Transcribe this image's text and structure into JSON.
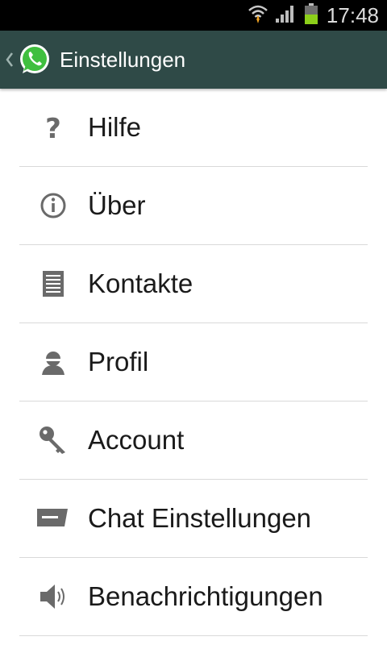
{
  "status_bar": {
    "time": "17:48",
    "icons": [
      "wifi-icon",
      "signal-icon",
      "battery-icon"
    ]
  },
  "action_bar": {
    "title": "Einstellungen",
    "logo": "whatsapp-logo",
    "background": "#2f4a47"
  },
  "menu": {
    "items": [
      {
        "label": "Hilfe",
        "icon": "question-icon"
      },
      {
        "label": "Über",
        "icon": "info-icon"
      },
      {
        "label": "Kontakte",
        "icon": "contacts-icon"
      },
      {
        "label": "Profil",
        "icon": "profile-icon"
      },
      {
        "label": "Account",
        "icon": "key-icon"
      },
      {
        "label": "Chat Einstellungen",
        "icon": "chat-icon"
      },
      {
        "label": "Benachrichtigungen",
        "icon": "speaker-icon"
      }
    ]
  }
}
